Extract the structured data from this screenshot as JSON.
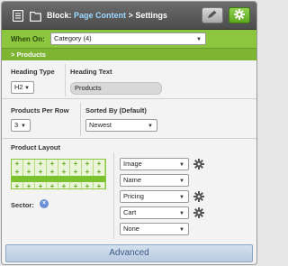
{
  "header": {
    "block_label": "Block:",
    "page_content": "Page Content",
    "separator": ">",
    "settings": "Settings",
    "icons": [
      "document-icon",
      "folder-icon",
      "pencil-icon",
      "gear-icon"
    ]
  },
  "when_on": {
    "label": "When On:",
    "value": "Category (4)"
  },
  "section_bar": {
    "label": "> Products"
  },
  "heading": {
    "type_label": "Heading Type",
    "type_value": "H2",
    "text_label": "Heading Text",
    "text_value": "Products"
  },
  "products": {
    "per_row_label": "Products Per Row",
    "per_row_value": "3",
    "sorted_label": "Sorted By (Default)",
    "sorted_value": "Newest"
  },
  "layout": {
    "label": "Product Layout",
    "sector_label": "Sector:",
    "plus_glyph": "+",
    "close_glyph": "×",
    "options": [
      {
        "value": "Image",
        "gear": true
      },
      {
        "value": "Name",
        "gear": false
      },
      {
        "value": "Pricing",
        "gear": true
      },
      {
        "value": "Cart",
        "gear": true
      },
      {
        "value": "None",
        "gear": false
      }
    ]
  },
  "footer": {
    "advanced_label": "Advanced"
  },
  "colors": {
    "accent_green": "#8cc63f",
    "title_bar": "#5a5a5a",
    "link_blue": "#9ed8ff",
    "advanced_blue": "#c7d6e8"
  }
}
